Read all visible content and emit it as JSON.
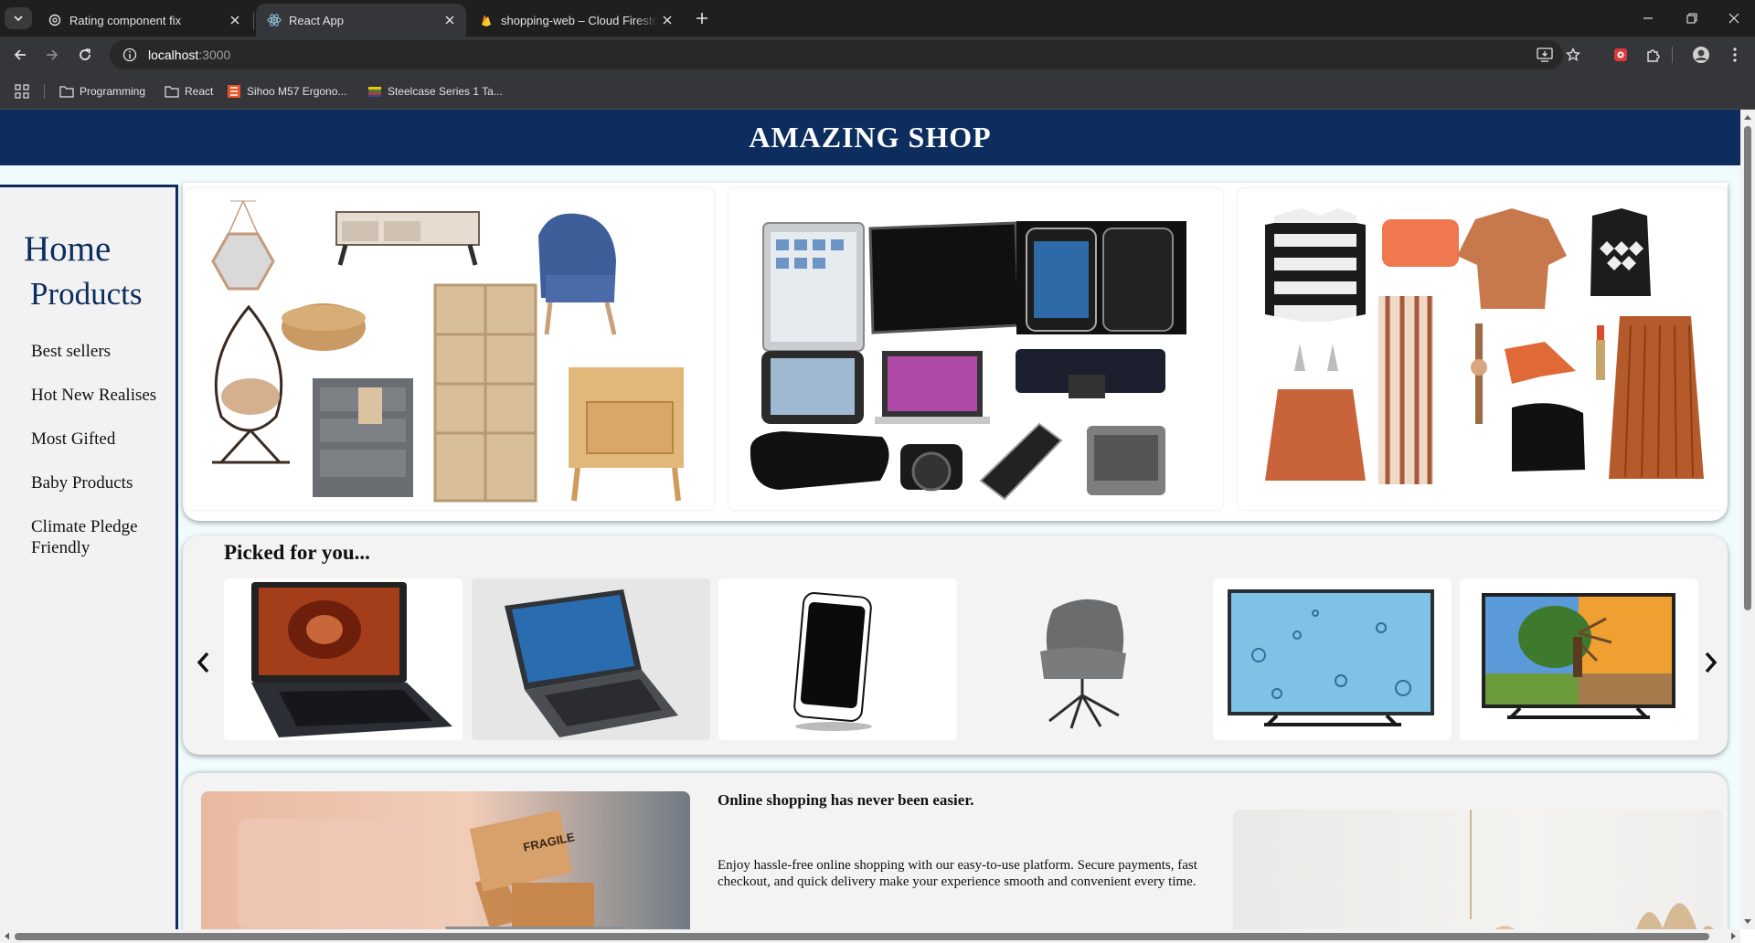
{
  "browser": {
    "tabs": [
      {
        "title": "Rating component fix",
        "icon": "openai-icon"
      },
      {
        "title": "React App",
        "icon": "react-icon"
      },
      {
        "title": "shopping-web – Cloud Firestore",
        "icon": "firebase-icon"
      }
    ],
    "url_host": "localhost",
    "url_port": ":3000",
    "bookmarks": [
      {
        "label": "Programming",
        "icon": "folder-icon"
      },
      {
        "label": "React",
        "icon": "folder-icon"
      },
      {
        "label": "Sihoo M57 Ergono...",
        "icon": "sihoo-favicon"
      },
      {
        "label": "Steelcase Series 1 Ta...",
        "icon": "steelcase-favicon"
      }
    ]
  },
  "site": {
    "title": "AMAZING SHOP"
  },
  "sidebar": {
    "home": "Home",
    "products": "Products",
    "links": [
      "Best sellers",
      "Hot New Realises",
      "Most Gifted",
      "Baby Products",
      "Climate Pledge Friendly"
    ]
  },
  "hero": {
    "cards": [
      "furniture-collage",
      "electronics-collage",
      "fashion-collage"
    ]
  },
  "picked": {
    "title": "Picked for you...",
    "items": [
      "laptop-wood-screen",
      "laptop-windows",
      "smartphone",
      "gray-armchair",
      "tv-water-drops",
      "tv-tree"
    ]
  },
  "promo": {
    "heading": "Online shopping has never been easier.",
    "text": "Enjoy hassle-free online shopping with our easy-to-use platform. Secure payments, fast checkout, and quick delivery make your experience smooth and convenient every time.",
    "box_label": "FRAGILE"
  },
  "colors": {
    "header_bg": "#0c2d5e",
    "page_bg": "#f0fbfd",
    "card_bg": "#f3f3f3"
  }
}
